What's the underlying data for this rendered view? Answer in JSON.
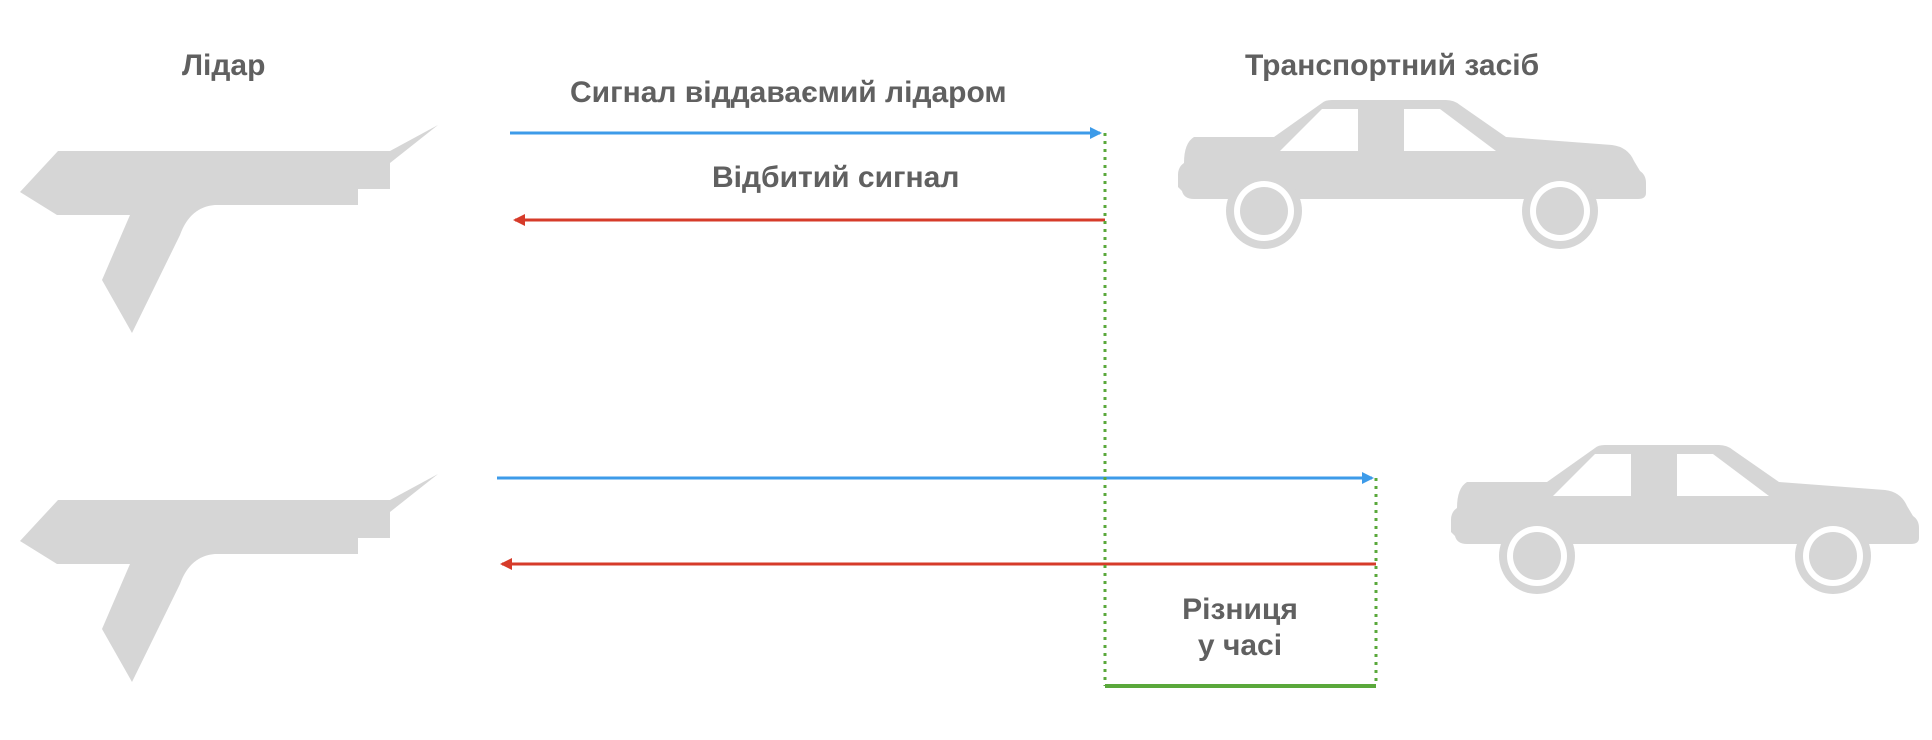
{
  "labels": {
    "lidar": "Лідар",
    "vehicle": "Транспортний засіб",
    "emitted_signal": "Сигнал віддаваємий лідаром",
    "reflected_signal": "Відбитий сигнал",
    "time_difference_line1": "Різниця",
    "time_difference_line2": "у часі"
  },
  "colors": {
    "emitted": "#3d9be9",
    "reflected": "#d63b2a",
    "time_marker": "#5aa83b",
    "silhouette": "#d6d6d6",
    "text": "#606060"
  },
  "icons": [
    "lidar-gun-icon",
    "car-icon"
  ]
}
